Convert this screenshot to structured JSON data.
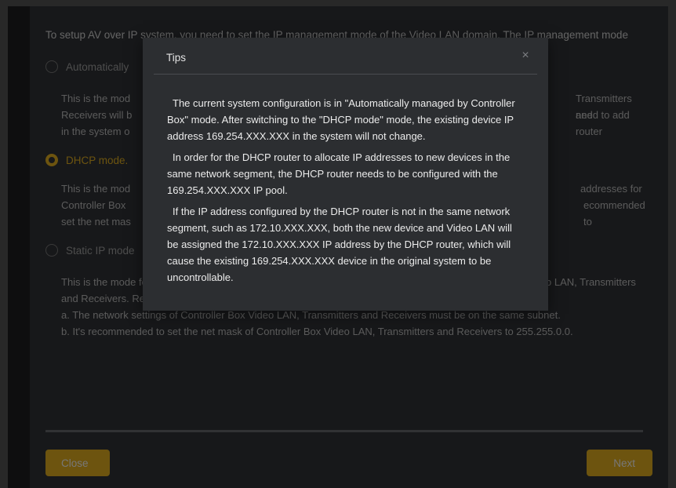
{
  "intro": "To setup AV over IP system, you need to set the IP management mode of the Video LAN domain. The IP management mode",
  "options": [
    {
      "label": "Automatically",
      "checked": false,
      "description": [
        "This is the mod",
        "Receivers will b",
        "in the system o"
      ]
    },
    {
      "label": "DHCP mode.",
      "checked": true,
      "description": [
        "This is the mod",
        "Controller Box",
        "set the net mas"
      ]
    },
    {
      "label": "Static IP mode",
      "checked": false,
      "description": []
    }
  ],
  "right_fragments": {
    "first": [
      "Transmitters and",
      "need to add router"
    ],
    "second": [
      "addresses for",
      "ecommended to"
    ]
  },
  "static_description": [
    "This is the mode for system in case IP address resources can be assigned manually for Controller Box Video LAN, Transmitters and Receivers. Reminders as below:",
    "a. The network settings of Controller Box Video LAN, Transmitters and Receivers must be on the same subnet.",
    "b. It's recommended to set the net mask of Controller Box Video LAN, Transmitters and Receivers to 255.255.0.0."
  ],
  "footer": {
    "close_label": "Close",
    "next_label": "Next"
  },
  "modal": {
    "title": "Tips",
    "close_glyph": "×",
    "paragraphs": [
      "The current system configuration is in \"Automatically managed by Controller Box\" mode. After switching to the \"DHCP mode\" mode, the existing device IP address 169.254.XXX.XXX in the system will not change.",
      "In order for the DHCP router to allocate IP addresses to new devices in the same network segment, the DHCP router needs to be configured with the 169.254.XXX.XXX IP pool.",
      "If the IP address configured by the DHCP router is not in the same network segment, such as 172.10.XXX.XXX, both the new device and Video LAN will be assigned the 172.10.XXX.XXX IP address by the DHCP router, which will cause the existing 169.254.XXX.XXX device in the original system to be uncontrollable."
    ]
  },
  "colors": {
    "accent": "#c69a1d",
    "panel": "#2b2d30",
    "modal": "#2c2e31"
  }
}
